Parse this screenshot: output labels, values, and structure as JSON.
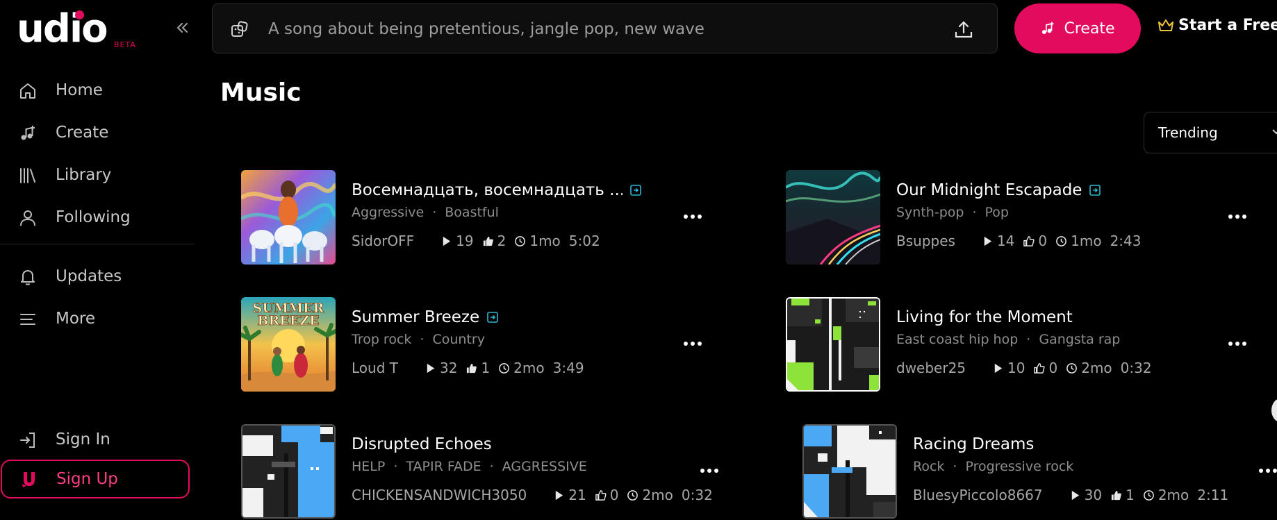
{
  "brand": {
    "logo_text": "udio",
    "badge": "BETA",
    "accent": "#e30b5d"
  },
  "sidebar": {
    "collapse_icon": "chevrons-left-icon",
    "items": [
      {
        "label": "Home",
        "icon": "home-icon"
      },
      {
        "label": "Create",
        "icon": "music-plus-icon"
      },
      {
        "label": "Library",
        "icon": "library-icon"
      },
      {
        "label": "Following",
        "icon": "user-icon"
      },
      {
        "label": "Updates",
        "icon": "bell-icon"
      },
      {
        "label": "More",
        "icon": "menu-lines-icon"
      }
    ],
    "sign_in": {
      "label": "Sign In",
      "icon": "sign-in-icon"
    },
    "sign_up": {
      "label": "Sign Up",
      "icon": "udio-u-icon"
    }
  },
  "topbar": {
    "search_placeholder": "A song about being pretentious, jangle pop, new wave",
    "create_label": "Create",
    "trial_label": "Start a Free T"
  },
  "main": {
    "title": "Music",
    "sort_value": "Trending",
    "songs": [
      {
        "title": "Восемнадцать, восемнадцать ...",
        "tags": [
          "Aggressive",
          "Boastful"
        ],
        "artist": "SidorOFF",
        "plays": "19",
        "likes": "2",
        "liked": true,
        "age": "1mo",
        "duration": "5:02",
        "art": "psychedelic-horses"
      },
      {
        "title": "Our Midnight Escapade",
        "tags": [
          "Synth-pop",
          "Pop"
        ],
        "artist": "Bsuppes",
        "plays": "14",
        "likes": "0",
        "liked": false,
        "age": "1mo",
        "duration": "2:43",
        "art": "neon-highway"
      },
      {
        "title": "Summer Breeze",
        "tags": [
          "Trop rock",
          "Country"
        ],
        "artist": "Loud T",
        "plays": "32",
        "likes": "1",
        "liked": true,
        "age": "2mo",
        "duration": "3:49",
        "art": "summer-breeze-poster",
        "art_text": [
          "SUMMER",
          "BREEZE"
        ]
      },
      {
        "title": "Living for the Moment",
        "tags": [
          "East coast hip hop",
          "Gangsta rap"
        ],
        "artist": "dweber25",
        "plays": "10",
        "likes": "0",
        "liked": false,
        "age": "2mo",
        "duration": "0:32",
        "art": "generative-green"
      },
      {
        "title": "Disrupted Echoes",
        "tags": [
          "HELP",
          "TAPIR FADE",
          "AGGRESSIVE"
        ],
        "artist": "CHICKENSANDWICH3050",
        "plays": "21",
        "likes": "0",
        "liked": false,
        "age": "2mo",
        "duration": "0:32",
        "art": "generative-blue"
      },
      {
        "title": "Racing Dreams",
        "tags": [
          "Rock",
          "Progressive rock"
        ],
        "artist": "BluesyPiccolo8667",
        "plays": "30",
        "likes": "1",
        "liked": true,
        "age": "2mo",
        "duration": "2:11",
        "art": "generative-blue"
      }
    ]
  }
}
